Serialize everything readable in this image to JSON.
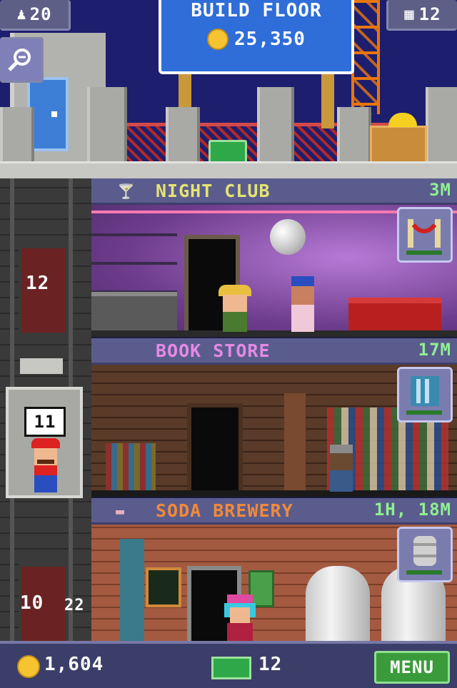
{
  "hud": {
    "population": "20",
    "floors_count": "12",
    "coins": "1,604",
    "bux": "12",
    "menu_label": "MENU"
  },
  "build": {
    "label": "BUILD FLOOR",
    "cost": "25,350"
  },
  "floors": [
    {
      "name": "NIGHT CLUB",
      "time": "3M",
      "name_color": "#e4e472",
      "icon": "velvet-rope-icon"
    },
    {
      "name": "BOOK STORE",
      "time": "17M",
      "name_color": "#e48ae4",
      "icon": "bookshelf-icon"
    },
    {
      "name": "SODA BREWERY",
      "time": "1H, 18M",
      "name_color": "#f08a3a",
      "icon": "soda-tank-icon"
    }
  ],
  "elevator": {
    "top_floor_label": "12",
    "car_floor_label": "11",
    "bottom_floor_label": "10",
    "bottom_floor_extra": "22"
  },
  "colors": {
    "coin": "#f5c430",
    "bux": "#2fa84a",
    "time_text": "#8ef08e"
  }
}
